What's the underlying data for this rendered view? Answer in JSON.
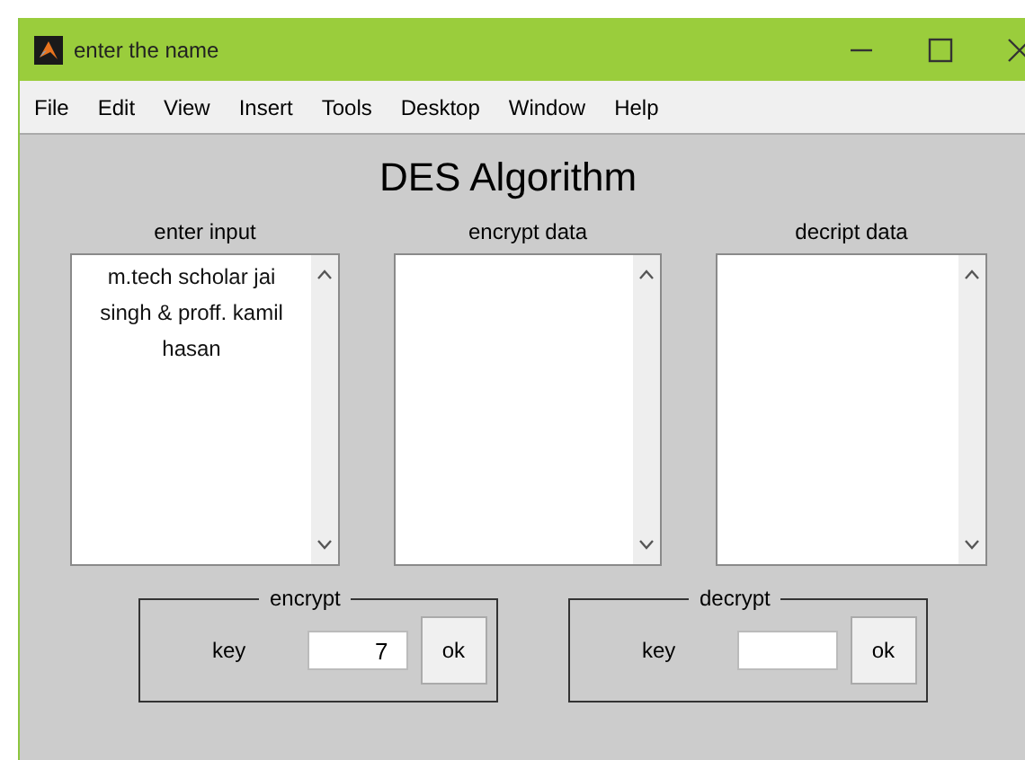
{
  "window": {
    "title": "enter the name"
  },
  "menu": [
    "File",
    "Edit",
    "View",
    "Insert",
    "Tools",
    "Desktop",
    "Window",
    "Help"
  ],
  "heading": "DES Algorithm",
  "text_areas": [
    {
      "label": "enter input",
      "value": "m.tech scholar jai singh & proff. kamil hasan"
    },
    {
      "label": "encrypt data"
    },
    {
      "label": "decript data"
    }
  ],
  "panels": [
    {
      "title": "encrypt",
      "key_label": "key",
      "key_value": "7",
      "button": "ok"
    },
    {
      "title": "decrypt",
      "key_label": "key",
      "button": "ok"
    }
  ]
}
